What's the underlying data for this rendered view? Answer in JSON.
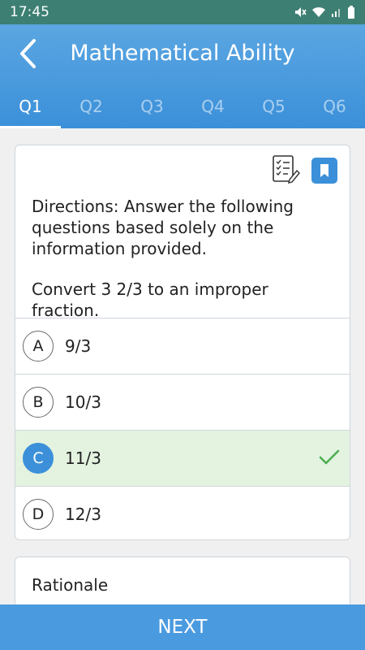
{
  "status_bar": {
    "time": "17:45",
    "icons": [
      "mute-icon",
      "wifi-icon",
      "signal-icon",
      "battery-icon"
    ]
  },
  "header": {
    "title": "Mathematical Ability",
    "back_icon": "chevron-left-icon",
    "tabs": [
      {
        "label": "Q1",
        "active": true
      },
      {
        "label": "Q2",
        "active": false
      },
      {
        "label": "Q3",
        "active": false
      },
      {
        "label": "Q4",
        "active": false
      },
      {
        "label": "Q5",
        "active": false
      },
      {
        "label": "Q6",
        "active": false
      }
    ]
  },
  "question": {
    "directions": "Directions: Answer the following questions based solely on the information provided.",
    "prompt": "Convert 3 2/3 to an improper fraction.",
    "tools": [
      "checklist-icon",
      "bookmark-icon"
    ],
    "options": [
      {
        "letter": "A",
        "text": "9/3",
        "correct": false
      },
      {
        "letter": "B",
        "text": "10/3",
        "correct": false
      },
      {
        "letter": "C",
        "text": "11/3",
        "correct": true
      },
      {
        "letter": "D",
        "text": "12/3",
        "correct": false
      }
    ]
  },
  "rationale": {
    "label": "Rationale"
  },
  "footer": {
    "next_label": "NEXT"
  },
  "colors": {
    "accent": "#3b90d9",
    "correct_bg": "#e3f3e0",
    "check": "#4caf50",
    "status_bar": "#3d7f73"
  }
}
